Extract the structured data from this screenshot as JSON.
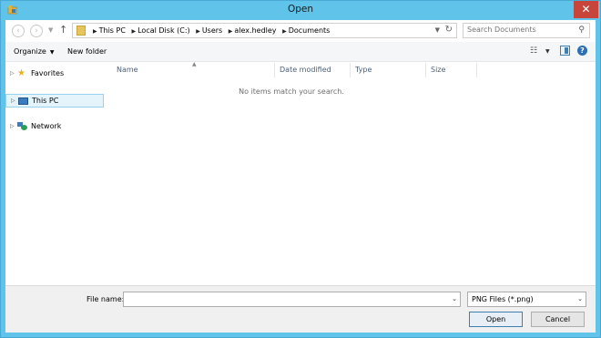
{
  "window": {
    "title": "Open",
    "close_glyph": "✕"
  },
  "address": {
    "crumbs": [
      "This PC",
      "Local Disk (C:)",
      "Users",
      "alex.hedley",
      "Documents"
    ],
    "search_placeholder": "Search Documents"
  },
  "toolbar": {
    "organize_label": "Organize",
    "new_folder_label": "New folder"
  },
  "nav": {
    "items": [
      {
        "label": "Favorites",
        "icon": "star-icon"
      },
      {
        "label": "This PC",
        "icon": "computer-icon",
        "selected": true
      },
      {
        "label": "Network",
        "icon": "network-icon"
      }
    ]
  },
  "file_list": {
    "columns": [
      "Name",
      "Date modified",
      "Type",
      "Size"
    ],
    "empty_message": "No items match your search."
  },
  "footer": {
    "file_name_label": "File name:",
    "file_name_value": "",
    "file_type": "PNG Files (*.png)",
    "open_label": "Open",
    "cancel_label": "Cancel"
  }
}
